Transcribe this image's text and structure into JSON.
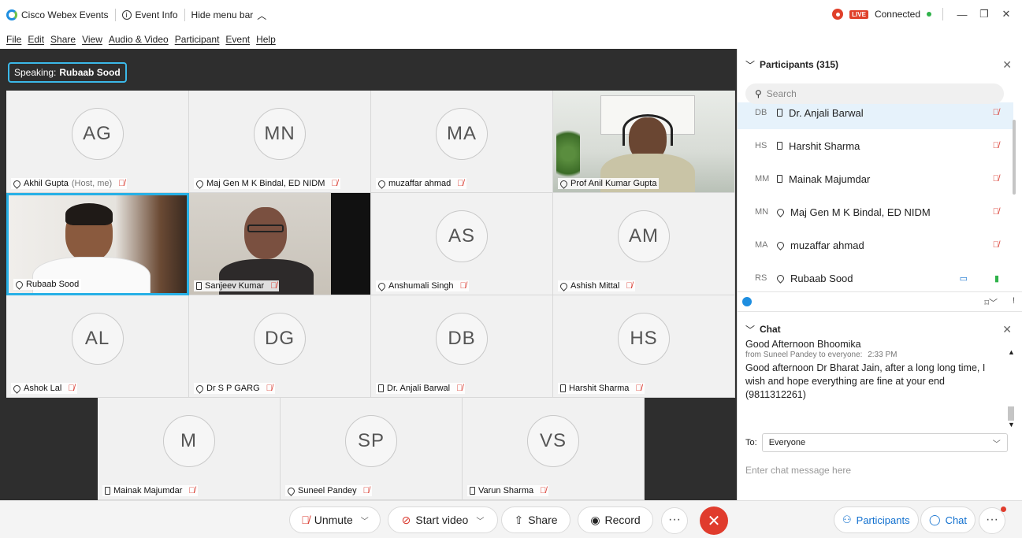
{
  "titlebar": {
    "app_name": "Cisco Webex Events",
    "event_info": "Event Info",
    "hide_menu": "Hide menu bar",
    "live": "LIVE",
    "status": "Connected"
  },
  "menu": [
    "File",
    "Edit",
    "Share",
    "View",
    "Audio & Video",
    "Participant",
    "Event",
    "Help"
  ],
  "speaking": {
    "prefix": "Speaking:",
    "name": "Rubaab Sood"
  },
  "tiles": [
    {
      "initials": "AG",
      "name": "Akhil Gupta",
      "extra": "(Host, me)"
    },
    {
      "initials": "MN",
      "name": "Maj Gen M K Bindal, ED NIDM"
    },
    {
      "initials": "MA",
      "name": "muzaffar ahmad"
    },
    {
      "name": "Prof Anil Kumar Gupta"
    },
    {
      "name": "Rubaab Sood"
    },
    {
      "name": "Sanjeev Kumar"
    },
    {
      "initials": "AS",
      "name": "Anshumali Singh"
    },
    {
      "initials": "AM",
      "name": "Ashish Mittal"
    },
    {
      "initials": "AL",
      "name": "Ashok Lal"
    },
    {
      "initials": "DG",
      "name": "Dr S P GARG"
    },
    {
      "initials": "DB",
      "name": "Dr. Anjali Barwal"
    },
    {
      "initials": "HS",
      "name": "Harshit Sharma"
    },
    {
      "initials": "M",
      "name": "Mainak Majumdar"
    },
    {
      "initials": "SP",
      "name": "Suneel Pandey"
    },
    {
      "initials": "VS",
      "name": "Varun Sharma"
    }
  ],
  "toolbar": {
    "unmute": "Unmute",
    "start_video": "Start video",
    "share": "Share",
    "record": "Record",
    "more": "···",
    "participants": "Participants",
    "chat": "Chat"
  },
  "participants_panel": {
    "title": "Participants (315)",
    "search_placeholder": "Search",
    "rows": [
      {
        "initials": "DB",
        "name": "Dr. Anjali Barwal"
      },
      {
        "initials": "HS",
        "name": "Harshit Sharma"
      },
      {
        "initials": "MM",
        "name": "Mainak Majumdar"
      },
      {
        "initials": "MN",
        "name": "Maj Gen M K Bindal, ED NIDM"
      },
      {
        "initials": "MA",
        "name": "muzaffar ahmad"
      },
      {
        "initials": "RS",
        "name": "Rubaab Sood"
      }
    ]
  },
  "chat_panel": {
    "title": "Chat",
    "prev_message": "Good Afternoon Bhoomika",
    "meta_from": "from Suneel Pandey to everyone:",
    "meta_time": "2:33 PM",
    "message": "Good afternoon Dr Bharat Jain, after a long long time, I wish and hope everything are fine at your end (9811312261)",
    "to_label": "To:",
    "to_value": "Everyone",
    "input_placeholder": "Enter chat message here"
  },
  "colors": {
    "accent": "#1170cf",
    "speaker_border": "#27b0e6",
    "muted": "#d9362b",
    "end_call": "#e03c2d"
  }
}
